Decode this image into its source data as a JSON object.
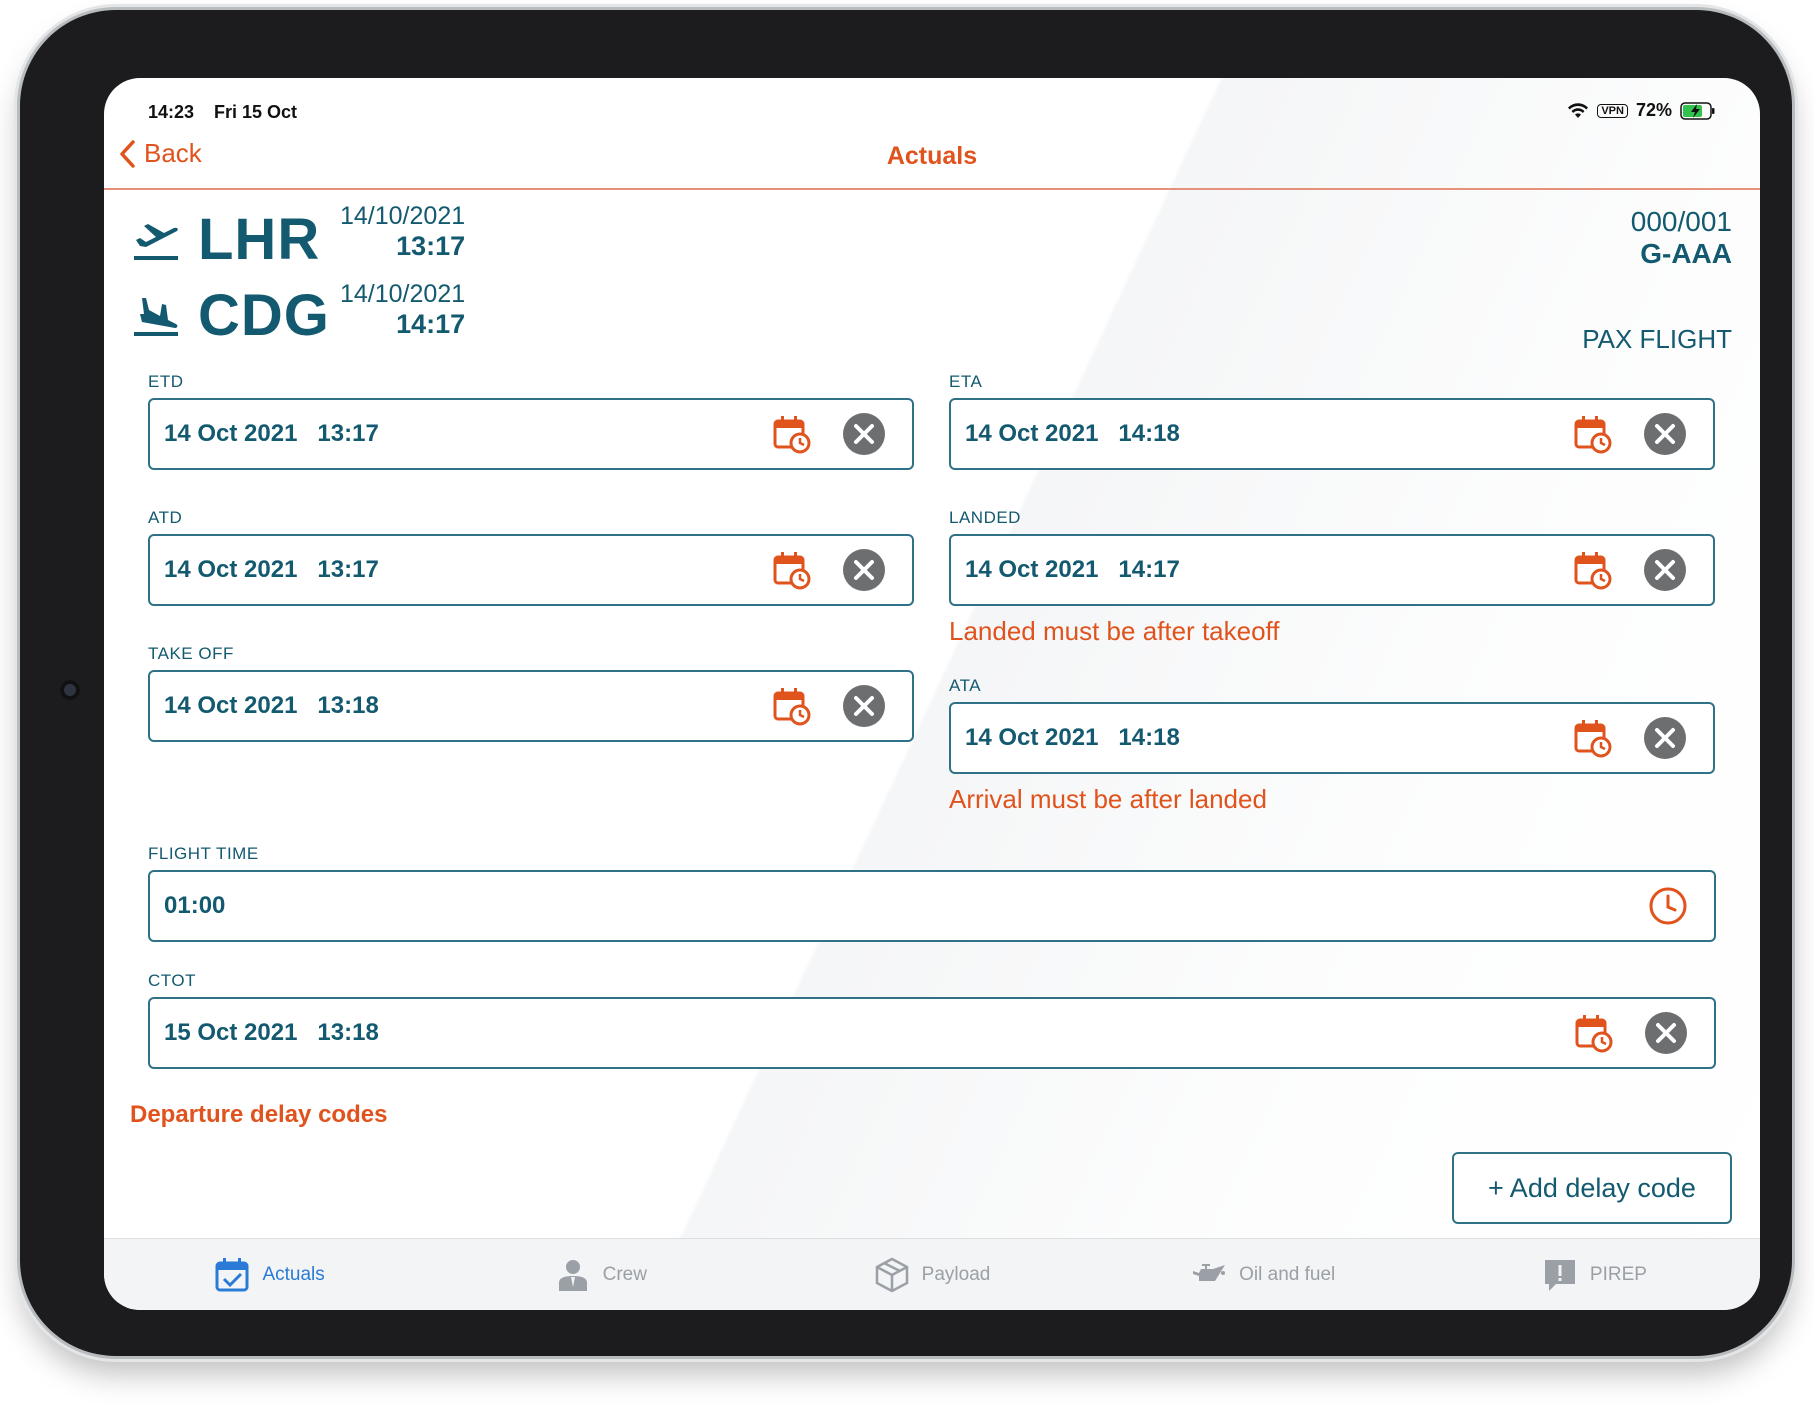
{
  "status_bar": {
    "time": "14:23",
    "date": "Fri 15 Oct",
    "vpn": "VPN",
    "battery": "72%"
  },
  "nav": {
    "back_label": "Back",
    "title": "Actuals"
  },
  "flight": {
    "departure": {
      "code": "LHR",
      "date": "14/10/2021",
      "time": "13:17"
    },
    "arrival": {
      "code": "CDG",
      "date": "14/10/2021",
      "time": "14:17"
    },
    "number": "000/001",
    "registration": "G-AAA",
    "type": "PAX FLIGHT"
  },
  "fields": {
    "etd": {
      "label": "ETD",
      "value": "14 Oct 2021   13:17"
    },
    "eta": {
      "label": "ETA",
      "value": "14 Oct 2021   14:18"
    },
    "atd": {
      "label": "ATD",
      "value": "14 Oct 2021   13:17"
    },
    "landed": {
      "label": "LANDED",
      "value": "14 Oct 2021   14:17",
      "error": "Landed must be after takeoff"
    },
    "takeoff": {
      "label": "TAKE OFF",
      "value": "14 Oct 2021   13:18"
    },
    "ata": {
      "label": "ATA",
      "value": "14 Oct 2021   14:18",
      "error": "Arrival must be after landed"
    },
    "flight_time": {
      "label": "FLIGHT TIME",
      "value": "01:00"
    },
    "ctot": {
      "label": "CTOT",
      "value": "15 Oct 2021   13:18"
    }
  },
  "delay": {
    "section_title": "Departure delay codes",
    "add_label": "+ Add delay code"
  },
  "tabs": [
    {
      "label": "Actuals",
      "icon": "calendar-check-icon",
      "active": true
    },
    {
      "label": "Crew",
      "icon": "person-icon",
      "active": false
    },
    {
      "label": "Payload",
      "icon": "box-icon",
      "active": false
    },
    {
      "label": "Oil and fuel",
      "icon": "oil-can-icon",
      "active": false
    },
    {
      "label": "PIREP",
      "icon": "alert-message-icon",
      "active": false
    }
  ],
  "colors": {
    "accent": "#e0531d",
    "primary": "#13596f",
    "border": "#2f7187",
    "error": "#e0531d",
    "tab_active": "#2a7bd5",
    "tab_inactive": "#9aa0a6"
  }
}
